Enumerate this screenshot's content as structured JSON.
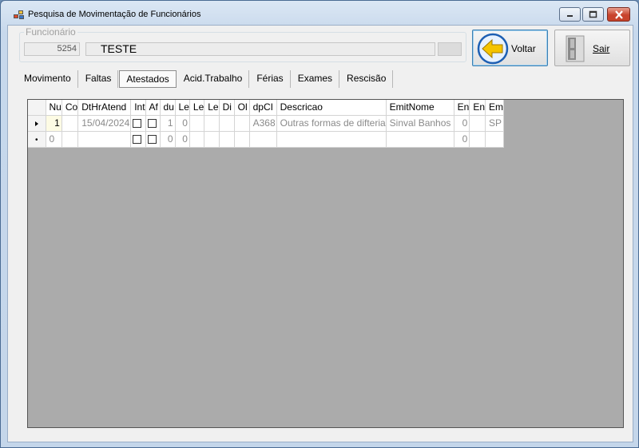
{
  "window": {
    "title": "Pesquisa de Movimentação de Funcionários"
  },
  "funcionario": {
    "group_label": "Funcionário",
    "code": "5254",
    "name": "TESTE"
  },
  "buttons": {
    "voltar": "Voltar",
    "sair": "Sair"
  },
  "tabs": [
    {
      "label": "Movimento"
    },
    {
      "label": "Faltas"
    },
    {
      "label": "Atestados",
      "active": true
    },
    {
      "label": "Acid.Trabalho"
    },
    {
      "label": "Férias"
    },
    {
      "label": "Exames"
    },
    {
      "label": "Rescisão"
    }
  ],
  "grid": {
    "columns": [
      "Nu",
      "Co",
      "DtHrAtend",
      "Int",
      "Af",
      "du",
      "Le",
      "Le",
      "Le",
      "Di",
      "Ol",
      "dpCI",
      "Descricao",
      "EmitNome",
      "En",
      "En",
      "Em"
    ],
    "rows": [
      {
        "marker": "current",
        "cells": [
          "1",
          "",
          "15/04/2024",
          "",
          "",
          "1",
          "0",
          "",
          "",
          "",
          "",
          "A368",
          "Outras formas de difteria",
          "Sinval Banhos",
          "0",
          "",
          "SP"
        ]
      },
      {
        "marker": "new",
        "cells": [
          "0",
          "",
          "",
          "",
          "",
          "0",
          "0",
          "",
          "",
          "",
          "",
          "",
          "",
          "",
          "0",
          "",
          ""
        ]
      }
    ]
  },
  "colors": {
    "grid_background": "#ababab",
    "accent_arrow": "#f5c400",
    "close_button": "#c7432b"
  }
}
